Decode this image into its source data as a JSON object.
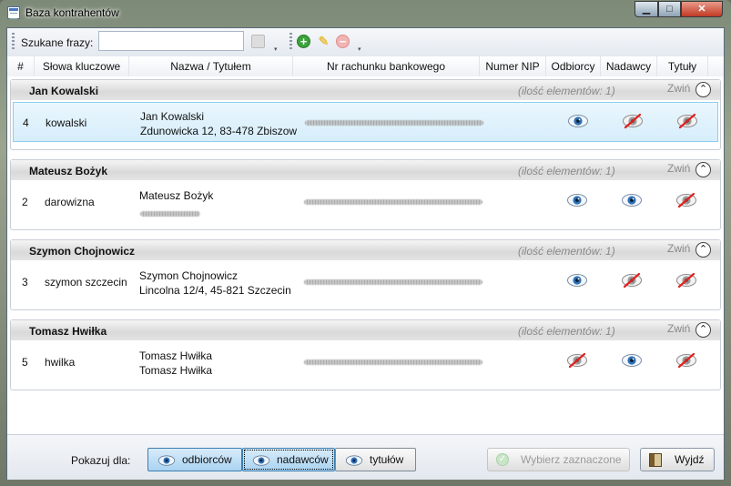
{
  "window": {
    "title": "Baza kontrahentów"
  },
  "toolbar": {
    "search_label": "Szukane frazy:",
    "search_value": ""
  },
  "columns": {
    "id": "#",
    "keywords": "Słowa kluczowe",
    "name": "Nazwa / Tytułem",
    "account": "Nr rachunku bankowego",
    "nip": "Numer NIP",
    "recipients": "Odbiorcy",
    "senders": "Nadawcy",
    "titles": "Tytuły"
  },
  "groups": [
    {
      "name": "Jan Kowalski",
      "count": "(ilość elementów: 1)",
      "collapse": "Zwiń",
      "row": {
        "id": "4",
        "keyword": "kowalski",
        "name1": "Jan Kowalski",
        "name2": "Zdunowicka 12, 83-478 Zbiszow",
        "recipients_visible": true,
        "senders_visible": false,
        "titles_visible": false,
        "selected": true
      }
    },
    {
      "name": "Mateusz Bożyk",
      "count": "(ilość elementów: 1)",
      "collapse": "Zwiń",
      "row": {
        "id": "2",
        "keyword": "darowizna",
        "name1": "Mateusz Bożyk",
        "name2": "",
        "recipients_visible": true,
        "senders_visible": true,
        "titles_visible": false,
        "selected": false
      }
    },
    {
      "name": "Szymon Chojnowicz",
      "count": "(ilość elementów: 1)",
      "collapse": "Zwiń",
      "row": {
        "id": "3",
        "keyword": "szymon szczecin",
        "name1": "Szymon Chojnowicz",
        "name2": "Lincolna 12/4, 45-821 Szczecin",
        "recipients_visible": true,
        "senders_visible": false,
        "titles_visible": false,
        "selected": false
      }
    },
    {
      "name": "Tomasz Hwiłka",
      "count": "(ilość elementów: 1)",
      "collapse": "Zwiń",
      "row": {
        "id": "5",
        "keyword": "hwilka",
        "name1": "Tomasz Hwiłka",
        "name2": "Tomasz Hwiłka",
        "recipients_visible": false,
        "senders_visible": true,
        "titles_visible": false,
        "selected": false
      }
    }
  ],
  "footer": {
    "show_for_label": "Pokazuj dla:",
    "recipients_toggle": "odbiorców",
    "senders_toggle": "nadawców",
    "titles_toggle": "tytułów",
    "select_button": "Wybierz zaznaczone",
    "exit_button": "Wyjdź"
  },
  "colors": {
    "accent": "#3c7fb1",
    "selection": "#d6eefb",
    "add": "#3aa33a",
    "edit": "#e8c24a",
    "delete": "#e07a7a"
  }
}
